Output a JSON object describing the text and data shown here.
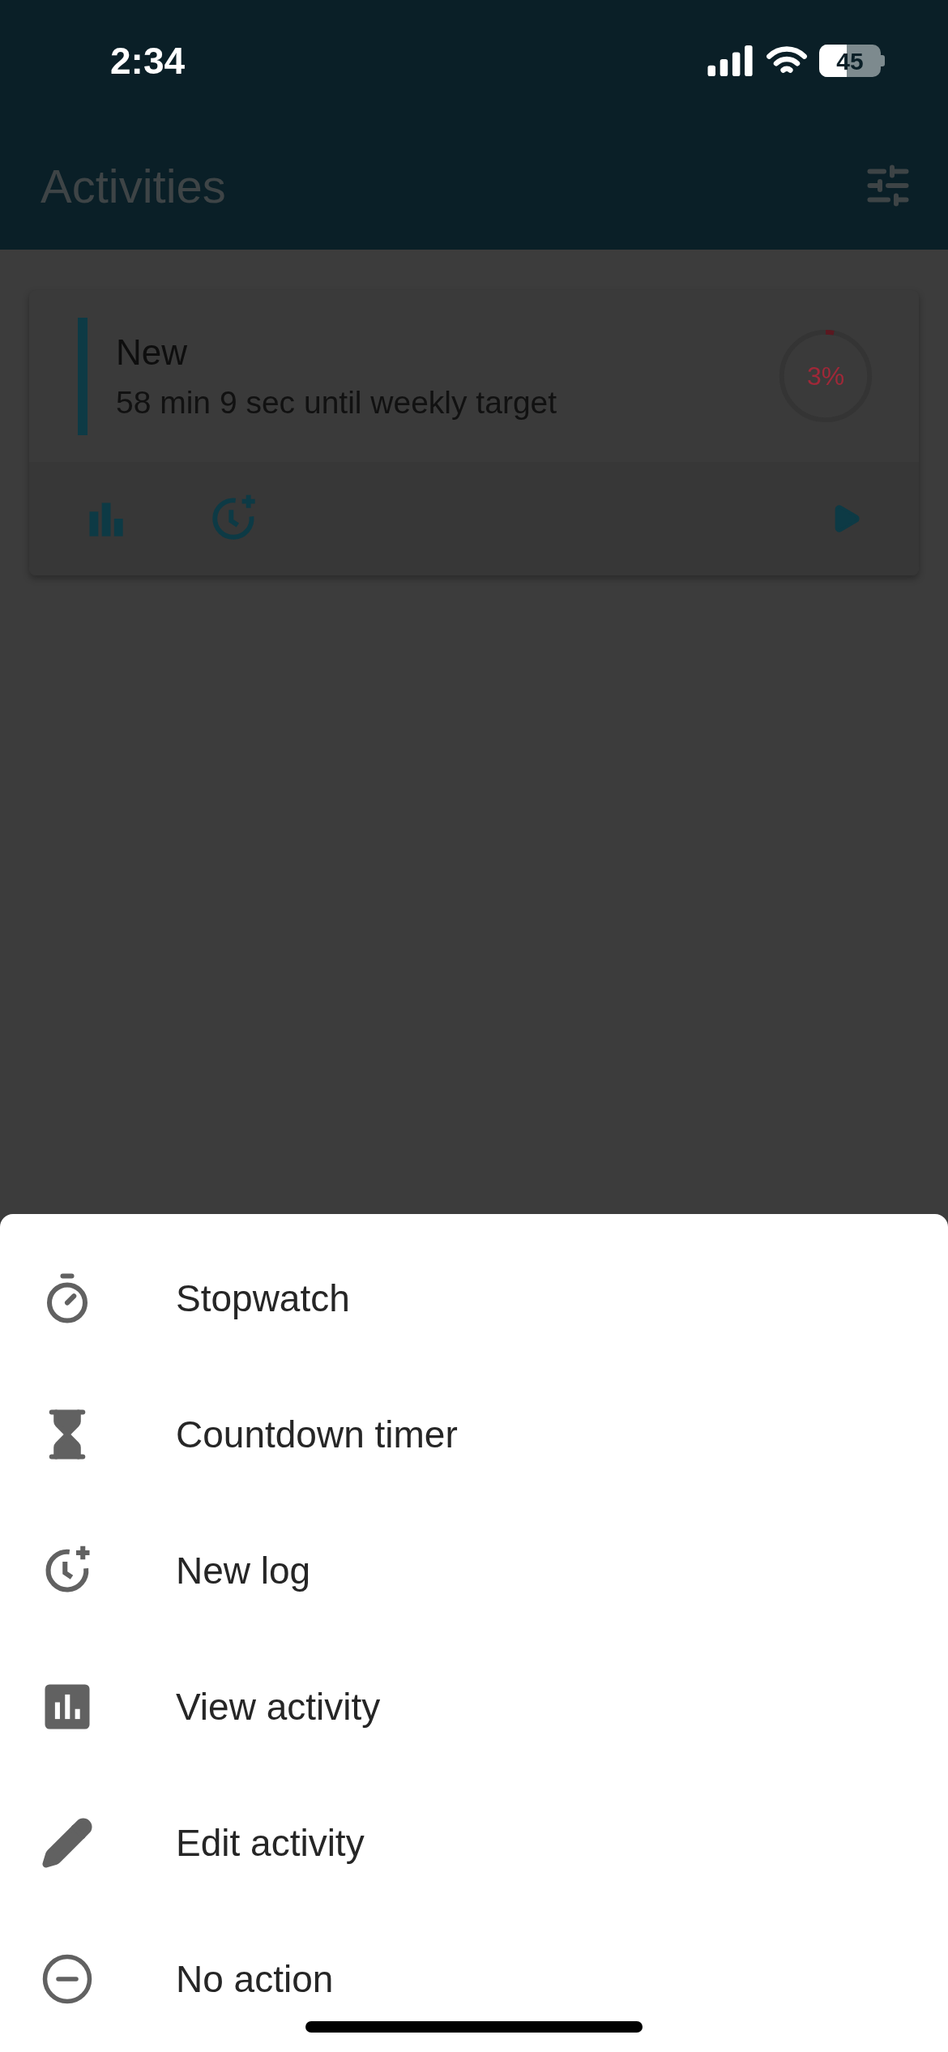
{
  "status_bar": {
    "time": "2:34",
    "battery": "45"
  },
  "header": {
    "title": "Activities"
  },
  "activity": {
    "name": "New",
    "subtitle": "58 min 9 sec until weekly target",
    "progress_label": "3%",
    "level": 0.03
  },
  "sheet": {
    "items": [
      {
        "label": "Stopwatch",
        "kind": "stopwatch"
      },
      {
        "label": "Countdown timer",
        "kind": "countdown"
      },
      {
        "label": "New log",
        "kind": "log"
      },
      {
        "label": "View activity",
        "kind": "view"
      },
      {
        "label": "Edit activity",
        "kind": "edit"
      },
      {
        "label": "No action",
        "kind": "none"
      }
    ]
  }
}
